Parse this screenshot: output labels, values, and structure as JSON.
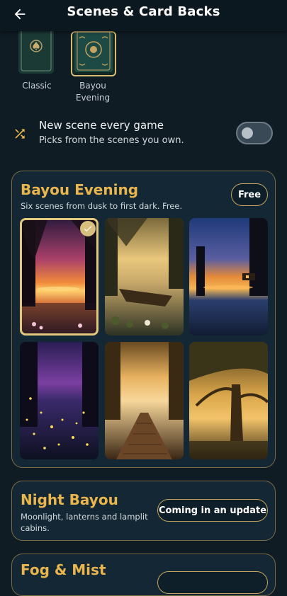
{
  "header": {
    "title": "Scenes & Card Backs",
    "back_icon": "arrow-left-icon"
  },
  "card_backs": [
    {
      "label": "Classic",
      "selected": false
    },
    {
      "label": "Bayou\nEvening",
      "selected": true
    }
  ],
  "scene_toggle": {
    "icon": "shuffle-icon",
    "title": "New scene every game",
    "subtitle": "Picks from the scenes you own.",
    "enabled": false
  },
  "packs": [
    {
      "title": "Bayou Evening",
      "subtitle": "Six scenes from dusk to first dark. Free.",
      "action_label": "Free",
      "scenes": [
        {
          "name": "sunset-cypress-scene",
          "selected": true
        },
        {
          "name": "misty-boat-scene",
          "selected": false
        },
        {
          "name": "dusk-cabin-scene",
          "selected": false
        },
        {
          "name": "firefly-night-scene",
          "selected": false
        },
        {
          "name": "boardwalk-scene",
          "selected": false
        },
        {
          "name": "oak-tree-scene",
          "selected": false
        }
      ]
    },
    {
      "title": "Night Bayou",
      "subtitle": "Moonlight, lanterns and lamplit cabins.",
      "action_label": "Coming in an update"
    },
    {
      "title": "Fog & Mist",
      "action_label": ""
    }
  ],
  "colors": {
    "background": "#0f1c24",
    "accent_gold": "#e9b54c",
    "panel": "#132834",
    "selection": "#e2c97d"
  }
}
